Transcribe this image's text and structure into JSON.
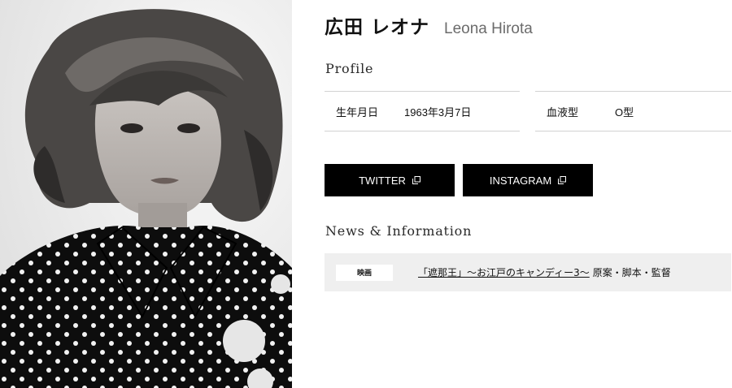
{
  "artist": {
    "name_jp": "広田 レオナ",
    "name_en": "Leona Hirota"
  },
  "profile": {
    "heading": "Profile",
    "birthday_label": "生年月日",
    "birthday_value": "1963年3月7日",
    "blood_label": "血液型",
    "blood_value": "O型"
  },
  "sns": {
    "twitter_label": "TWITTER",
    "instagram_label": "INSTAGRAM",
    "icon": "external-link-icon"
  },
  "news": {
    "heading": "News & Information",
    "items": [
      {
        "tag": "映画",
        "link_text": "「遮那王」～お江戸のキャンディー3～",
        "suffix": "原案・脚本・監督"
      }
    ]
  },
  "colors": {
    "button_bg": "#000000",
    "button_text": "#ffffff",
    "news_row_bg": "#efefef",
    "divider": "#d2d2d2",
    "name_en": "#6b6b6b"
  }
}
